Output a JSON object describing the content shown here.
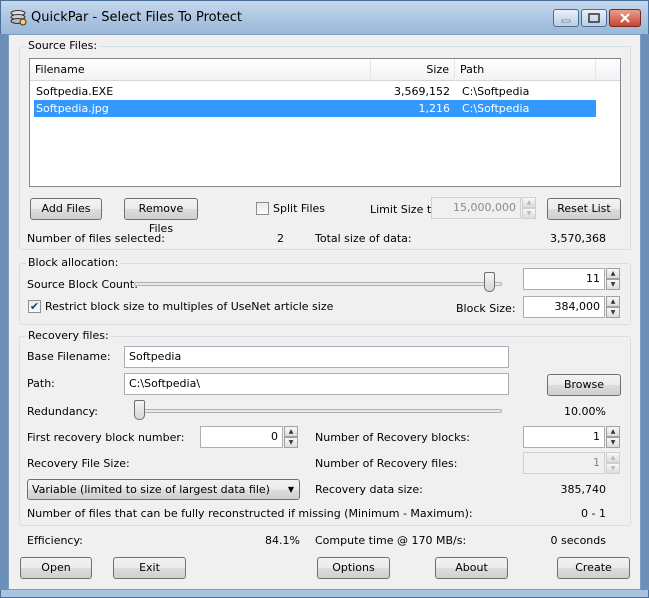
{
  "window": {
    "title": "QuickPar - Select Files To Protect",
    "controls": [
      "minimize",
      "maximize",
      "close"
    ]
  },
  "source_files": {
    "group_label": "Source Files:",
    "columns": [
      "Filename",
      "Size",
      "Path"
    ],
    "rows": [
      {
        "filename": "Softpedia.EXE",
        "size": "3,569,152",
        "path": "C:\\Softpedia",
        "selected": false
      },
      {
        "filename": "Softpedia.jpg",
        "size": "1,216",
        "path": "C:\\Softpedia",
        "selected": true
      }
    ],
    "add_files_label": "Add Files",
    "remove_files_label": "Remove Files",
    "split_files_label": "Split Files",
    "split_files_checked": false,
    "limit_size_label": "Limit Size to:",
    "limit_size_value": "15,000,000",
    "reset_list_label": "Reset List",
    "files_selected_label": "Number of files selected:",
    "files_selected_value": "2",
    "total_size_label": "Total size of data:",
    "total_size_value": "3,570,368"
  },
  "block_allocation": {
    "group_label": "Block allocation:",
    "source_block_count_label": "Source Block Count:",
    "source_block_count_value": "11",
    "slider_position": 0.98,
    "restrict_label": "Restrict block size to multiples of UseNet article size",
    "restrict_checked": true,
    "block_size_label": "Block Size:",
    "block_size_value": "384,000"
  },
  "recovery_files": {
    "group_label": "Recovery files:",
    "base_filename_label": "Base Filename:",
    "base_filename_value": "Softpedia",
    "path_label": "Path:",
    "path_value": "C:\\Softpedia\\",
    "browse_label": "Browse",
    "redundancy_label": "Redundancy:",
    "redundancy_value": "10.00%",
    "redundancy_slider_position": 0.0,
    "first_block_label": "First recovery block number:",
    "first_block_value": "0",
    "num_recovery_blocks_label": "Number of Recovery blocks:",
    "num_recovery_blocks_value": "1",
    "recovery_file_size_label": "Recovery File Size:",
    "num_recovery_files_label": "Number of Recovery files:",
    "num_recovery_files_value": "1",
    "file_size_mode_value": "Variable (limited to size of largest data file)",
    "recovery_data_size_label": "Recovery data size:",
    "recovery_data_size_value": "385,740",
    "reconstruct_label": "Number of files that can be fully reconstructed if missing (Minimum - Maximum):",
    "reconstruct_value": "0 - 1"
  },
  "footer": {
    "efficiency_label": "Efficiency:",
    "efficiency_value": "84.1%",
    "compute_time_label": "Compute time @ 170 MB/s:",
    "compute_time_value": "0 seconds",
    "open_label": "Open",
    "exit_label": "Exit",
    "options_label": "Options",
    "about_label": "About",
    "create_label": "Create"
  }
}
